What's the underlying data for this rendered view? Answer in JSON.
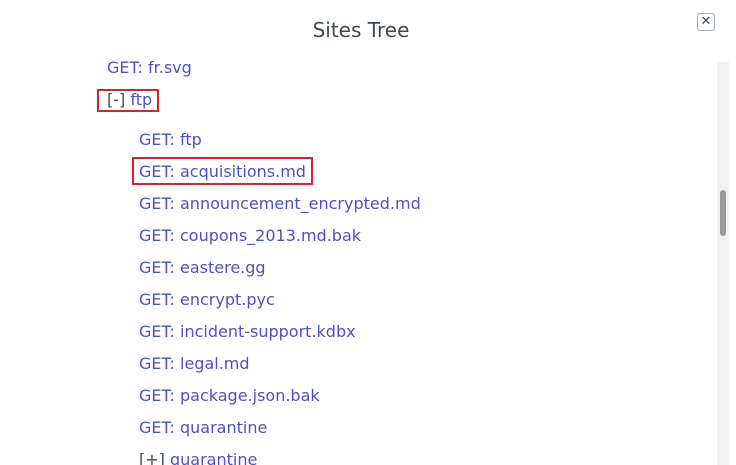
{
  "dialog": {
    "title": "Sites Tree",
    "close_label": "✕"
  },
  "tree": {
    "items": [
      {
        "label": "GET: fr.svg"
      },
      {
        "toggle": "[-]",
        "label": "ftp"
      },
      {
        "label": "GET: ftp"
      },
      {
        "label": "GET: acquisitions.md"
      },
      {
        "label": "GET: announcement_encrypted.md"
      },
      {
        "label": "GET: coupons_2013.md.bak"
      },
      {
        "label": "GET: eastere.gg"
      },
      {
        "label": "GET: encrypt.pyc"
      },
      {
        "label": "GET: incident-support.kdbx"
      },
      {
        "label": "GET: legal.md"
      },
      {
        "label": "GET: package.json.bak"
      },
      {
        "label": "GET: quarantine"
      },
      {
        "toggle": "[+]",
        "label": "quarantine"
      }
    ]
  },
  "colors": {
    "link": "#4a52c6",
    "highlight": "#d6232d",
    "title": "#3f4a56"
  }
}
